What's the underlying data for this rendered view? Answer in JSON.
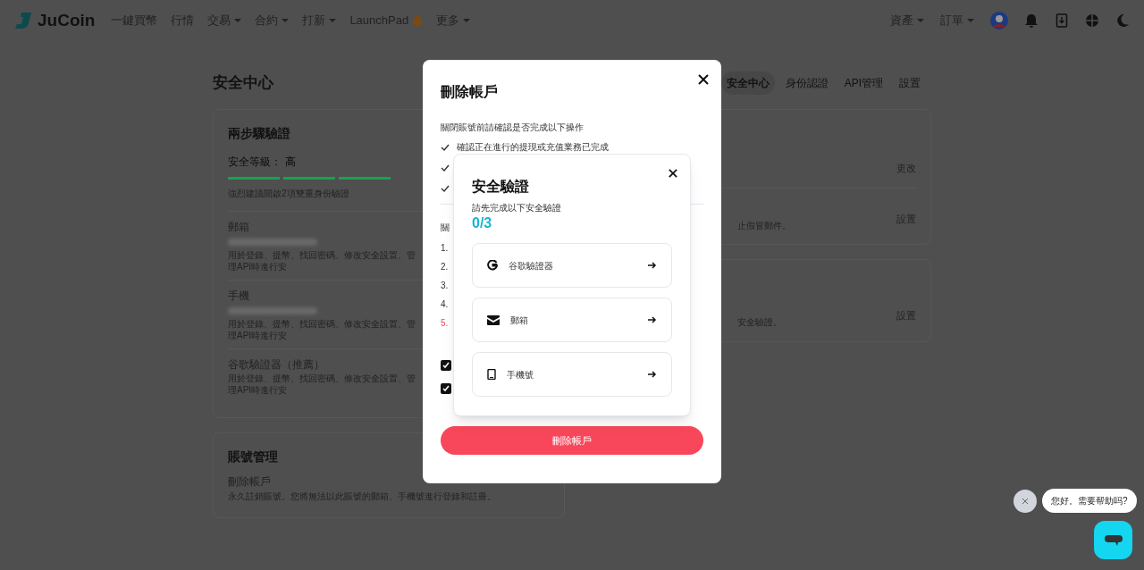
{
  "nav": {
    "logo": "JuCoin",
    "items": [
      {
        "label": "一鍵買幣",
        "kind": "link"
      },
      {
        "label": "行情",
        "kind": "link"
      },
      {
        "label": "交易",
        "kind": "menu"
      },
      {
        "label": "合約",
        "kind": "menu"
      },
      {
        "label": "打新",
        "kind": "menu"
      },
      {
        "label": "LaunchPad",
        "kind": "hot"
      },
      {
        "label": "更多",
        "kind": "menu"
      }
    ],
    "right": [
      {
        "label": "資產",
        "kind": "menu"
      },
      {
        "label": "訂單",
        "kind": "menu"
      }
    ]
  },
  "page": {
    "title": "安全中心",
    "tabs": [
      {
        "label": "安全中心",
        "selected": true
      },
      {
        "label": "身份認證",
        "selected": false
      },
      {
        "label": "API管理",
        "selected": false
      },
      {
        "label": "設置",
        "selected": false
      }
    ]
  },
  "two_step": {
    "title": "兩步驟驗證",
    "level_label": "安全等級：",
    "level_value": "高",
    "segments": [
      {
        "on": true
      },
      {
        "on": true
      },
      {
        "on": true
      }
    ],
    "hint": "強烈建議開啟2項雙重身份驗證",
    "items": [
      {
        "label": "郵箱",
        "redacted": true,
        "desc": "用於登錄、提幣、找回密碼、修改安全設置、管理API時進行安"
      },
      {
        "label": "手機",
        "redacted": true,
        "desc": "用於登錄、提幣、找回密碼、修改安全設置、管理API時進行安"
      },
      {
        "label": "谷歌驗證器（推薦）",
        "redacted": false,
        "desc": "用於登錄、提幣、找回密碼、修改安全設置、管理API時進行安"
      }
    ]
  },
  "right_cards": [
    {
      "rows": [
        {
          "action": "更改"
        },
        {
          "fragment": "止假冒郵件。",
          "action": "設置"
        }
      ]
    },
    {
      "rows": [
        {
          "fragment": "安全驗證。",
          "action": "設置"
        }
      ]
    }
  ],
  "account": {
    "title": "賬號管理",
    "item": "刪除帳戶",
    "desc": "永久註銷賬號。您將無法以此賬號的郵箱、手機號進行登錄和註冊。"
  },
  "delete_modal": {
    "title": "刪除帳戶",
    "intro": "關閉賬號前請確認是否完成以下操作",
    "checks": [
      {
        "checked": true,
        "text": "確認正在進行的提現或充值業務已完成"
      },
      {
        "checked": true
      },
      {
        "checked": true
      }
    ],
    "section_label": "關",
    "steps": [
      {
        "text": "1.",
        "warning": false
      },
      {
        "text": "2.",
        "warning": false
      },
      {
        "text": "3.",
        "warning": false
      },
      {
        "text": "4.",
        "warning": false
      },
      {
        "text": "5.",
        "warning": true
      }
    ],
    "agreements": [
      {
        "checked": true
      },
      {
        "checked": true
      }
    ],
    "button": "刪除帳戶"
  },
  "verify_modal": {
    "title": "安全驗證",
    "subtitle": "請先完成以下安全驗證",
    "progress": "0/3",
    "methods": [
      {
        "kind": "google",
        "label": "谷歌驗證器"
      },
      {
        "kind": "email",
        "label": "郵箱"
      },
      {
        "kind": "phone",
        "label": "手機號"
      }
    ]
  },
  "chat": {
    "bubble": "您好。需要帮助吗?"
  }
}
